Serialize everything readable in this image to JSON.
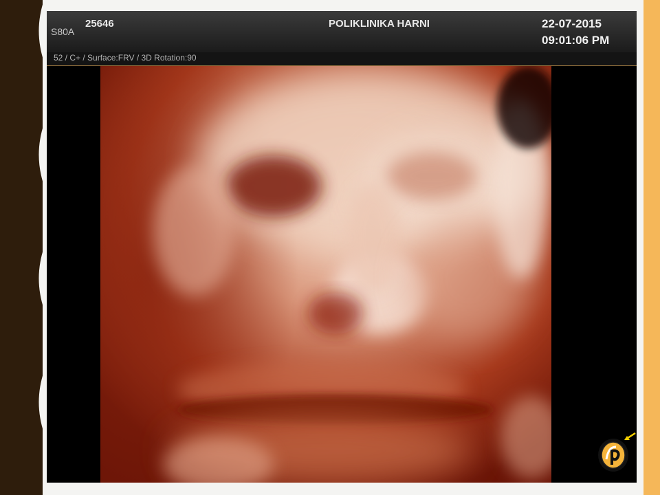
{
  "header": {
    "model": "S80A",
    "patient_id": "25646",
    "clinic": "POLIKLINIKA HARNI",
    "date": "22-07-2015",
    "time": "09:01:06 PM"
  },
  "info_bar": {
    "text": "52 / C+ / Surface:FRV / 3D Rotation:90"
  },
  "render": {
    "colors": {
      "slide_dark": "#2e1d0c",
      "accent_stripe": "#f5b759",
      "skin_highlight": "#f2d6c4",
      "skin_mid": "#c8704a",
      "skin_shadow": "#7a1808"
    }
  },
  "widgets": {
    "orientation_icon": "3d-orientation-icon",
    "arrow_icon": "yellow-arrow-icon"
  }
}
